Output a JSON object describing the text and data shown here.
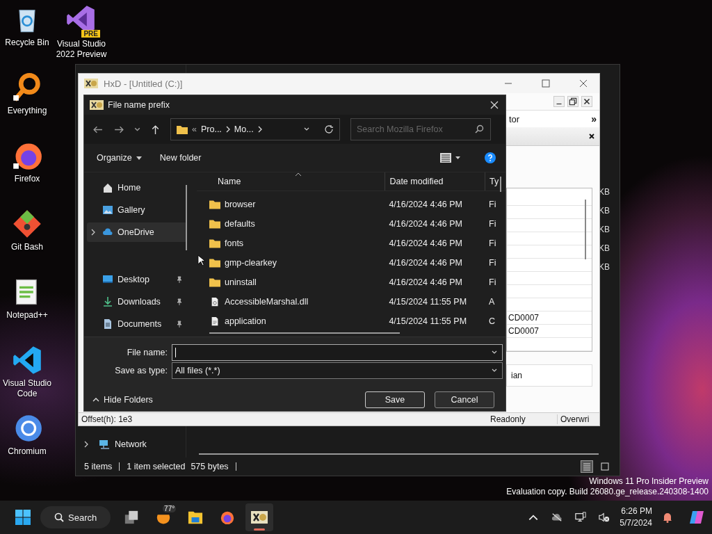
{
  "desktop_icons": [
    {
      "label": "Recycle Bin",
      "kind": "recycle"
    },
    {
      "label": "Everything",
      "kind": "magnifier"
    },
    {
      "label": "Firefox",
      "kind": "firefox"
    },
    {
      "label": "Git Bash",
      "kind": "git"
    },
    {
      "label": "Notepad++",
      "kind": "notepad"
    },
    {
      "label": "Visual Studio Code",
      "kind": "vscode"
    },
    {
      "label": "Chromium",
      "kind": "chromium"
    }
  ],
  "desktop_icons_column_2": [
    {
      "label": "Visual Studio 2022 Preview",
      "kind": "vs",
      "badge": "PRE"
    }
  ],
  "explorer_window": {
    "nav_items": [
      {
        "label": "Network",
        "expandable": true
      }
    ],
    "size_cells": [
      "KB",
      "KB",
      "KB",
      "KB",
      "KB"
    ],
    "status_bar": {
      "item_count": "5 items",
      "selection": "1 item selected",
      "size": "575 bytes"
    },
    "views": [
      {
        "kind": "details",
        "selected": true
      },
      {
        "kind": "tiles",
        "selected": false
      }
    ]
  },
  "hxd_window": {
    "title": "HxD - [Untitled (C:)]",
    "panel_tab": "tor",
    "panel_more": "»",
    "rows": [
      "CD0007",
      "CD0007"
    ],
    "field": "ian",
    "status_bar": {
      "offset": "Offset(h): 1e3",
      "access": "Readonly",
      "mode": "Overwri"
    }
  },
  "dialog": {
    "title": "File name prefix",
    "breadcrumbs": [
      "Pro...",
      "Mo..."
    ],
    "breadcrumb_overflow": "«",
    "search": {
      "placeholder": "Search Mozilla Firefox"
    },
    "toolbar": {
      "organize": "Organize",
      "new_folder": "New folder"
    },
    "nav_items": [
      {
        "label": "Home",
        "kind": "home",
        "expandable": false,
        "pinned": false,
        "selected": false
      },
      {
        "label": "Gallery",
        "kind": "gallery",
        "expandable": false,
        "pinned": false,
        "selected": false
      },
      {
        "label": "OneDrive",
        "kind": "cloud",
        "expandable": true,
        "pinned": false,
        "selected": true
      },
      {
        "label": "Desktop",
        "kind": "desktop",
        "expandable": false,
        "pinned": true,
        "selected": false
      },
      {
        "label": "Downloads",
        "kind": "download",
        "expandable": false,
        "pinned": true,
        "selected": false
      },
      {
        "label": "Documents",
        "kind": "documents",
        "expandable": false,
        "pinned": true,
        "selected": false
      }
    ],
    "columns": [
      "Name",
      "Date modified",
      "Ty"
    ],
    "files": [
      {
        "name": "browser",
        "kind": "folder",
        "date": "4/16/2024 4:46 PM",
        "type": "Fi",
        "selected": false
      },
      {
        "name": "defaults",
        "kind": "folder",
        "date": "4/16/2024 4:46 PM",
        "type": "Fi",
        "selected": false
      },
      {
        "name": "fonts",
        "kind": "folder",
        "date": "4/16/2024 4:46 PM",
        "type": "Fi",
        "selected": false
      },
      {
        "name": "gmp-clearkey",
        "kind": "folder",
        "date": "4/16/2024 4:46 PM",
        "type": "Fi",
        "selected": false
      },
      {
        "name": "uninstall",
        "kind": "folder",
        "date": "4/16/2024 4:46 PM",
        "type": "Fi",
        "selected": false
      },
      {
        "name": "AccessibleMarshal.dll",
        "kind": "dll",
        "date": "4/15/2024 11:55 PM",
        "type": "A",
        "selected": false
      },
      {
        "name": "application",
        "kind": "file",
        "date": "4/15/2024 11:55 PM",
        "type": "C",
        "selected": false
      }
    ],
    "file_name": {
      "label": "File name:",
      "focused": true
    },
    "save_type": {
      "label": "Save as type:",
      "value": "All files (*.*)"
    },
    "hide_folders": "Hide Folders",
    "buttons": [
      "Save",
      "Cancel"
    ]
  },
  "watermark_lines": [
    "Windows 11 Pro Insider Preview",
    "Evaluation copy. Build 26080.ge_release.240308-1400"
  ],
  "taskbar": {
    "search": "Search",
    "weather": "77°",
    "apps": [
      {
        "kind": "taskview",
        "active": false
      },
      {
        "kind": "weather",
        "active": false
      },
      {
        "kind": "explorer",
        "active": false
      },
      {
        "kind": "firefox",
        "active": false
      },
      {
        "kind": "hxd",
        "active": true
      }
    ],
    "time": "6:26 PM",
    "date": "5/7/2024"
  }
}
